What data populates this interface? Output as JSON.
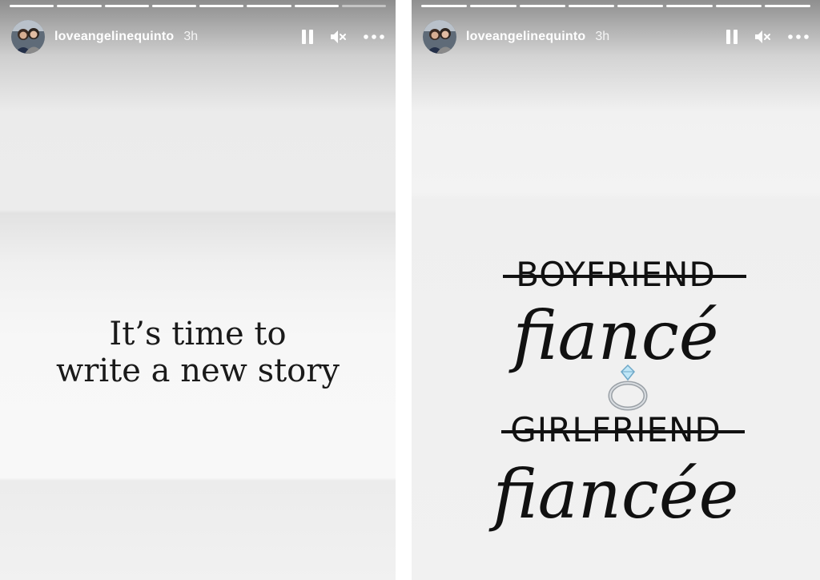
{
  "stories": [
    {
      "username": "loveangelinequinto",
      "time": "3h",
      "progress_total": 8,
      "progress_done": 7,
      "lines": [
        "It’s time to",
        "write a new story"
      ]
    },
    {
      "username": "loveangelinequinto",
      "time": "3h",
      "progress_total": 8,
      "progress_done": 8,
      "graphic": {
        "word1_struck": "BOYFRIEND",
        "word1_new": "fiancé",
        "word2_struck": "GIRLFRIEND",
        "word2_new": "fiancée"
      }
    }
  ],
  "icons": {
    "pause": "pause-icon",
    "mute": "mute-icon",
    "more": "more-options-icon",
    "ring": "ring-icon"
  },
  "colors": {
    "text": "#111111",
    "header_text": "#ffffff"
  }
}
